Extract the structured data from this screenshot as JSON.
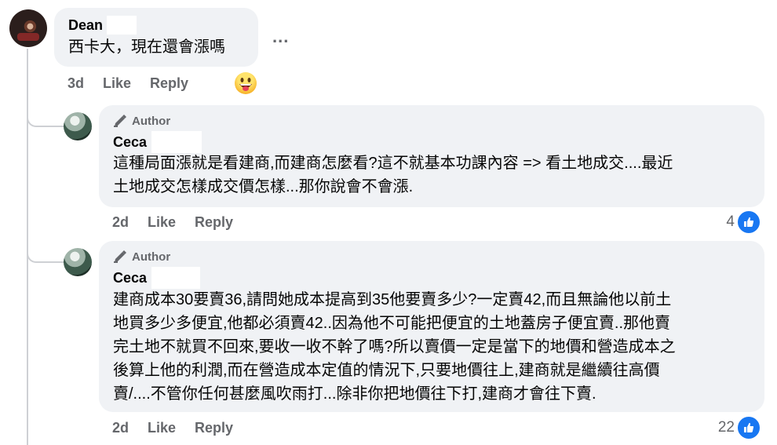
{
  "thread": {
    "top_comment": {
      "author": "Dean",
      "text": "西卡大，現在還會漲嗎",
      "time": "3d",
      "like_label": "Like",
      "reply_label": "Reply",
      "more_label": "...",
      "reaction_icon": "grinning-tongue-emoji"
    },
    "replies": [
      {
        "badge": "Author",
        "author": "Ceca",
        "text": "這種局面漲就是看建商,而建商怎麼看?這不就基本功課內容 => 看土地成交....最近\n土地成交怎樣成交價怎樣...那你說會不會漲.",
        "time": "2d",
        "like_label": "Like",
        "reply_label": "Reply",
        "like_count": "4"
      },
      {
        "badge": "Author",
        "author": "Ceca",
        "text": "建商成本30要賣36,請問她成本提高到35他要賣多少?一定賣42,而且無論他以前土\n地買多少多便宜,他都必須賣42..因為他不可能把便宜的土地蓋房子便宜賣..那他賣\n完土地不就買不回來,要收一收不幹了嗎?所以賣價一定是當下的地價和營造成本之\n後算上他的利潤,而在營造成本定值的情況下,只要地價往上,建商就是繼續往高價\n賣/....不管你任何甚麼風吹雨打...除非你把地價往下打,建商才會往下賣.",
        "time": "2d",
        "like_label": "Like",
        "reply_label": "Reply",
        "like_count": "22"
      }
    ]
  },
  "colors": {
    "bubble": "#f0f2f5",
    "secondary_text": "#65676b",
    "like_blue": "#1877f2",
    "thread_line": "#ced0d4"
  }
}
